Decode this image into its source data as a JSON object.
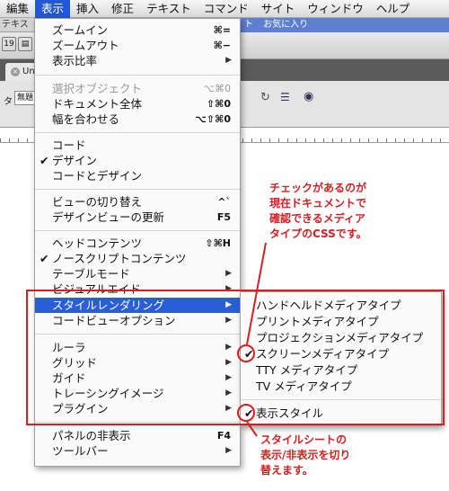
{
  "menubar": [
    "編集",
    "表示",
    "挿入",
    "修正",
    "テキスト",
    "コマンド",
    "サイト",
    "ウィンドウ",
    "ヘルプ"
  ],
  "background": {
    "strip_text": "テキス",
    "tabs_right": [
      "ト",
      "お気に入り"
    ],
    "doc_tab": "Un",
    "title_label": "タ",
    "title_value": "無題"
  },
  "menu": {
    "items": [
      {
        "label": "ズームイン",
        "shortcut": "⌘=",
        "state": "normal"
      },
      {
        "label": "ズームアウト",
        "shortcut": "⌘−",
        "state": "normal"
      },
      {
        "label": "表示比率",
        "submenu": true,
        "state": "normal"
      },
      {
        "label": "選択オブジェクト",
        "shortcut": "⌥⌘0",
        "state": "disabled"
      },
      {
        "label": "ドキュメント全体",
        "shortcut": "⇧⌘0",
        "state": "normal"
      },
      {
        "label": "幅を合わせる",
        "shortcut": "⌥⇧⌘0",
        "state": "normal"
      },
      {
        "label": "コード",
        "state": "normal"
      },
      {
        "label": "デザイン",
        "checked": true,
        "state": "normal"
      },
      {
        "label": "コードとデザイン",
        "state": "normal"
      },
      {
        "label": "ビューの切り替え",
        "shortcut": "^`",
        "state": "normal"
      },
      {
        "label": "デザインビューの更新",
        "shortcut": "F5",
        "state": "normal"
      },
      {
        "label": "ヘッドコンテンツ",
        "shortcut": "⇧⌘H",
        "state": "normal"
      },
      {
        "label": "ノースクリプトコンテンツ",
        "checked": true,
        "state": "normal"
      },
      {
        "label": "テーブルモード",
        "submenu": true,
        "state": "normal"
      },
      {
        "label": "ビジュアルエイド",
        "submenu": true,
        "state": "normal"
      },
      {
        "label": "スタイルレンダリング",
        "submenu": true,
        "state": "selected"
      },
      {
        "label": "コードビューオプション",
        "submenu": true,
        "state": "normal"
      },
      {
        "label": "ルーラ",
        "submenu": true,
        "state": "normal"
      },
      {
        "label": "グリッド",
        "submenu": true,
        "state": "normal"
      },
      {
        "label": "ガイド",
        "submenu": true,
        "state": "normal"
      },
      {
        "label": "トレーシングイメージ",
        "submenu": true,
        "state": "normal"
      },
      {
        "label": "プラグイン",
        "submenu": true,
        "state": "normal"
      },
      {
        "label": "パネルの非表示",
        "shortcut": "F4",
        "state": "normal"
      },
      {
        "label": "ツールバー",
        "submenu": true,
        "state": "normal"
      }
    ]
  },
  "submenu": {
    "items": [
      {
        "label": "ハンドヘルドメディアタイプ"
      },
      {
        "label": "プリントメディアタイプ"
      },
      {
        "label": "プロジェクションメディアタイプ"
      },
      {
        "label": "スクリーンメディアタイプ",
        "checked": true
      },
      {
        "label": "TTY メディアタイプ"
      },
      {
        "label": "TV メディアタイプ"
      },
      {
        "label": "表示スタイル",
        "checked": true
      }
    ]
  },
  "annotations": {
    "note_top": [
      "チェックがあるのが",
      "現在ドキュメントで",
      "確認できるメディア",
      "タイプのCSSです。"
    ],
    "note_bottom": [
      "スタイルシートの",
      "表示/非表示を切り",
      "替えます。"
    ],
    "color": "#d42020"
  },
  "colors": {
    "selection": "#2a5ed8",
    "menubar_active": "#2357d8"
  },
  "icons": [
    "checkmark-icon",
    "submenu-arrow-icon",
    "close-icon",
    "refresh-icon",
    "eye-icon"
  ]
}
